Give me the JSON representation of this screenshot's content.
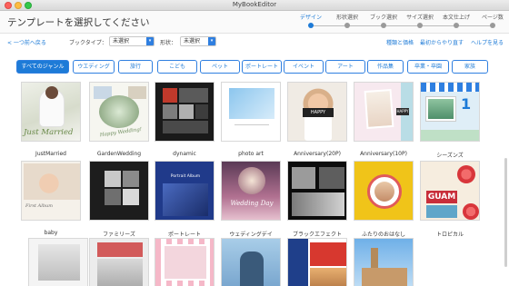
{
  "window": {
    "title": "MyBookEditor"
  },
  "header": {
    "title": "テンプレートを選択してください",
    "steps": [
      "デザイン",
      "形状選択",
      "ブック選択",
      "サイズ選択",
      "本文仕上げ",
      "ページ数"
    ],
    "active_step": 0
  },
  "toolbar": {
    "back_label": "< 一つ前へ戻る",
    "book_type_label": "ブックタイプ：",
    "book_type_value": "未選択",
    "shape_label": "形状：",
    "shape_value": "未選択",
    "links": [
      "種類と価格",
      "最初からやり直す",
      "ヘルプを見る"
    ]
  },
  "genres": {
    "items": [
      "すべてのジャンル",
      "ウエディング",
      "旅行",
      "こども",
      "ペット",
      "ポートレート",
      "イベント",
      "アート",
      "作品集",
      "卒業・卒園",
      "家族"
    ],
    "active": 0
  },
  "templates": [
    {
      "name": "JustMarried",
      "cover_text": "Just Married"
    },
    {
      "name": "GardenWedding",
      "cover_text": "Happy Wedding!"
    },
    {
      "name": "dynamic",
      "cover_text": ""
    },
    {
      "name": "photo art",
      "cover_text": ""
    },
    {
      "name": "Anniversary(20P)",
      "cover_text": "HAPPY"
    },
    {
      "name": "Anniversary(10P)",
      "cover_text": "HAPPY"
    },
    {
      "name": "シーズンズ",
      "cover_text": "1"
    },
    {
      "name": "baby",
      "cover_text": "First Album"
    },
    {
      "name": "ファミリーズ",
      "cover_text": ""
    },
    {
      "name": "ポートレート",
      "cover_text": "Portrait Album"
    },
    {
      "name": "ウェディングデイ",
      "cover_text": "Wedding Day"
    },
    {
      "name": "ブラックエフェクト",
      "cover_text": ""
    },
    {
      "name": "ふたりのおはなし",
      "cover_text": ""
    },
    {
      "name": "トロピカル",
      "cover_text": "GUAM"
    },
    {
      "name": "",
      "cover_text": ""
    },
    {
      "name": "",
      "cover_text": ""
    },
    {
      "name": "",
      "cover_text": ""
    },
    {
      "name": "",
      "cover_text": ""
    },
    {
      "name": "",
      "cover_text": ""
    },
    {
      "name": "",
      "cover_text": ""
    }
  ]
}
